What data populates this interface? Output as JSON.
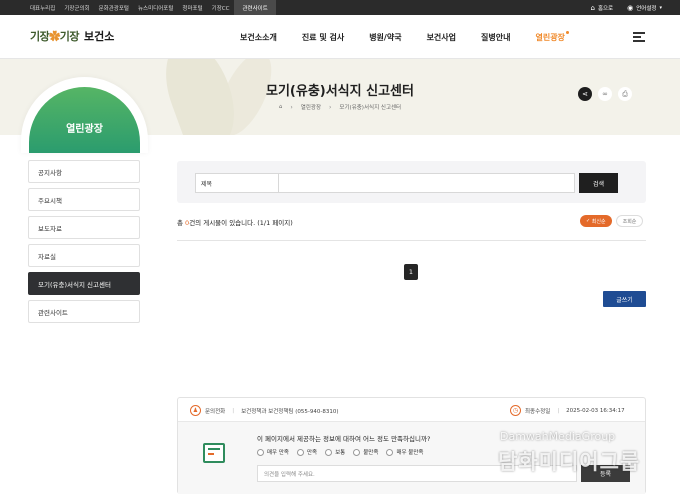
{
  "topbar": {
    "links": [
      "대표누리집",
      "기장군의회",
      "문화관광포털",
      "뉴스미디어포털",
      "청마포털",
      "기장CC",
      "관련사이트"
    ],
    "home": "홈으로",
    "language": "언어설정"
  },
  "header": {
    "logo_mark": "기장",
    "logo_mark_2": "기장",
    "logo_name": "보건소",
    "nav": [
      "보건소소개",
      "진료 및 검사",
      "병원/약국",
      "보건사업",
      "질병안내",
      "열린광장"
    ]
  },
  "visual": {
    "title": "모기(유충)서식지 신고센터",
    "breadcrumb": [
      "열린광장",
      "모기(유충)서식지 신고센터"
    ]
  },
  "side": {
    "title": "열린광장",
    "items": [
      "공지사항",
      "주요시책",
      "보도자료",
      "자료실",
      "모기(유충)서식지 신고센터",
      "관련사이트"
    ]
  },
  "search": {
    "select_value": "제목",
    "input_value": "",
    "button": "검색"
  },
  "list": {
    "total_prefix": "총 ",
    "total_count": "0",
    "total_suffix": "건의 게시물이 있습니다. (1/1 페이지)",
    "sort_latest": "최신순",
    "sort_views": "조회순",
    "current_page": "1",
    "write_button": "글쓰기"
  },
  "info": {
    "contact_label": "문의전화",
    "contact_value": "보건정책과 보건정책팀 (055-940-8310)",
    "updated_label": "최종수정일",
    "updated_value": "2025-02-03 16:34:17",
    "question": "이 페이지에서 제공하는 정보에 대하여 어느 정도 만족하십니까?",
    "options": [
      "매우 만족",
      "만족",
      "보통",
      "불만족",
      "매우 불만족"
    ],
    "feedback_placeholder": "의견을 입력해 주세요.",
    "submit": "등록"
  },
  "watermark": {
    "line1": "DamwahMediaGroup",
    "line2": "담화미디어그룹"
  }
}
